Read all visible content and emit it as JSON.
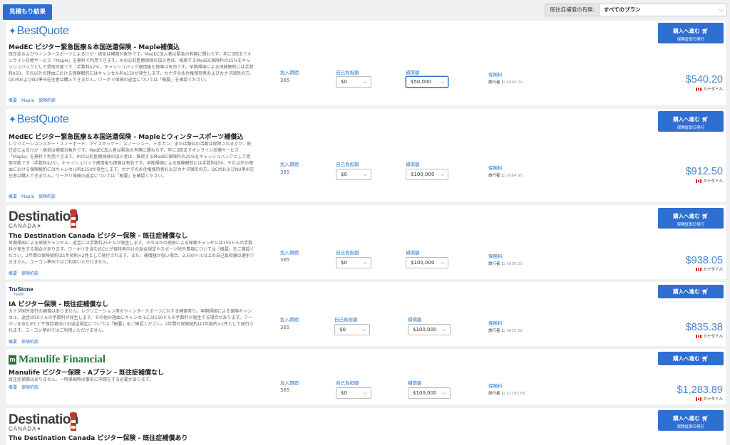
{
  "header": {
    "results_button": "見積もり結果",
    "filter_label": "既往症補償の有無:",
    "filter_value": "すべてのプラン"
  },
  "labels": {
    "period": "加入期間",
    "deductible": "自己負担額",
    "coverage": "補償額",
    "premium": "保険料",
    "traveler_prefix": "旅行者 1:",
    "currency": "カナダドル",
    "buy_main": "購入へ進む",
    "buy_sub": "保険証即日発行"
  },
  "quotes": [
    {
      "logo": "BestQuote",
      "title": "MedEC ビジター緊急医療＆本国送還保険 - Maple補償込",
      "description": "既往症およびウィンタースポーツによるけが・病気は補償対象外です。MedEC加入者は緊急の有無に関わらず、年に3回までオンライン診療サービス「Maple」を無料で利用できます。州の公的医療保険の加入者は、推奨するMedEC保険料の25%をキャッシュバックとして受取可能です（手数料$25）。キャッシュバック適用後も保険は有効です。早期帰国による保険解約には手数料$50、それ以外の理由における保険解約にはキャンセル料$150が発生します。カナダの永住権保持者およびカナダ国民の方、QC州およびNU準州在住者は購入できません。ワーホリ保険の返金については「概要」を確認ください。",
      "links": [
        "概要",
        "Maple",
        "保険約款"
      ],
      "period": "365",
      "deductible": "$0",
      "coverage": "$50,000",
      "traveler_amount": "$540.20",
      "price": "$540.20"
    },
    {
      "logo": "BestQuote",
      "title": "MedEC ビジター緊急医療＆本国送還保険 - Mapleとウィンタースポーツ補償込",
      "description": "レクリエーションスキー・スノーボード、アイスホッケー、スノーシュー、トボガン、または類似の活動は保障されますが、既往症によるけが・病気は補償対象外です。MedEC加入者は緊急の有無に関わらず、年に3回までオンライン診療サービス「Maple」を無料で利用できます。州の公的医療保険の加入者は、推奨するMedEC保険料の25%をキャッシュバックとして受取可能です（手数料$25）。キャッシュバック適用後も保険は有効です。早期帰国による保険解約には手数料$50、それ以外の理由における保険解約にはキャンセル料$150が発生します。カナダの永住権保持者およびカナダ国民の方、QC州およびNU準州在住者は購入できません。ワーホリ保険の返金については「概要」を確認ください。",
      "links": [
        "概要",
        "Maple",
        "保険約款"
      ],
      "period": "365",
      "deductible": "$0",
      "coverage": "$100,000",
      "traveler_amount": "$584.95",
      "price": "$912.50"
    },
    {
      "logo": "Destination",
      "logo_sub": "CANADA",
      "title": "The Destination Canada ビジター保険 - 既往症補償なし",
      "description": "早期帰国による保険キャンセル、返金には手数料25ドルが発生します。そのほかの理由による保険キャンセルは150ドルの手数料が発生する場合があります。ワーホリを含むIECビザ保持者向けの返金規定やスポーツ除外事項については「概要」をご確認ください。2年間の保険契約は1年契約×2件として発行されます。また、補償額が低い場合、2,500ドル以上の自己負担額は選択できません。ユーコン準州ではご利用いただけません。",
      "links": [
        "概要",
        "保険約款"
      ],
      "period": "365",
      "deductible": "$0",
      "coverage": "$100,000",
      "traveler_amount": "$938.05",
      "price": "$938.05"
    },
    {
      "logo": "TruStone",
      "logo_sub": "health",
      "title": "IA ビジター保険 - 既往症補償なし",
      "description": "カナダ国外旅行の補償はありません。レクリエーション用のウィンタースポーツに対する補償有り。早期帰国による保険キャンセル、返金は50ドルの手数料が発生します。その他の理由にキャンセルには150ドルの手数料が発生する場合があります。ワーホリを含むIECビザ保持者向けの返金規定については「概要」をご確認ください。2年間の保険契約は1年契約×2件として発行されます。ユーコン準州ではご利用いただけません。",
      "links": [
        "概要",
        "保険約款"
      ],
      "period": "365",
      "deductible": "$0",
      "coverage": "$100,000",
      "traveler_amount": "$835.38",
      "price": "$835.38"
    },
    {
      "logo": "Manulife Financial",
      "title": "Manulife ビジター保険 - Aプラン - 既往症補償なし",
      "description": "既往症補償はありません。一時帰国時は事前に申請をする必要があります。",
      "links": [
        "概要",
        "保険約款"
      ],
      "period": "365",
      "deductible": "$0",
      "coverage": "$100,000",
      "traveler_amount": "$1283.89",
      "price": "$1,283.89"
    },
    {
      "logo": "Destination",
      "logo_sub": "CANADA",
      "title": "The Destination Canada ビジター保険 - 既往症補償あり"
    }
  ]
}
